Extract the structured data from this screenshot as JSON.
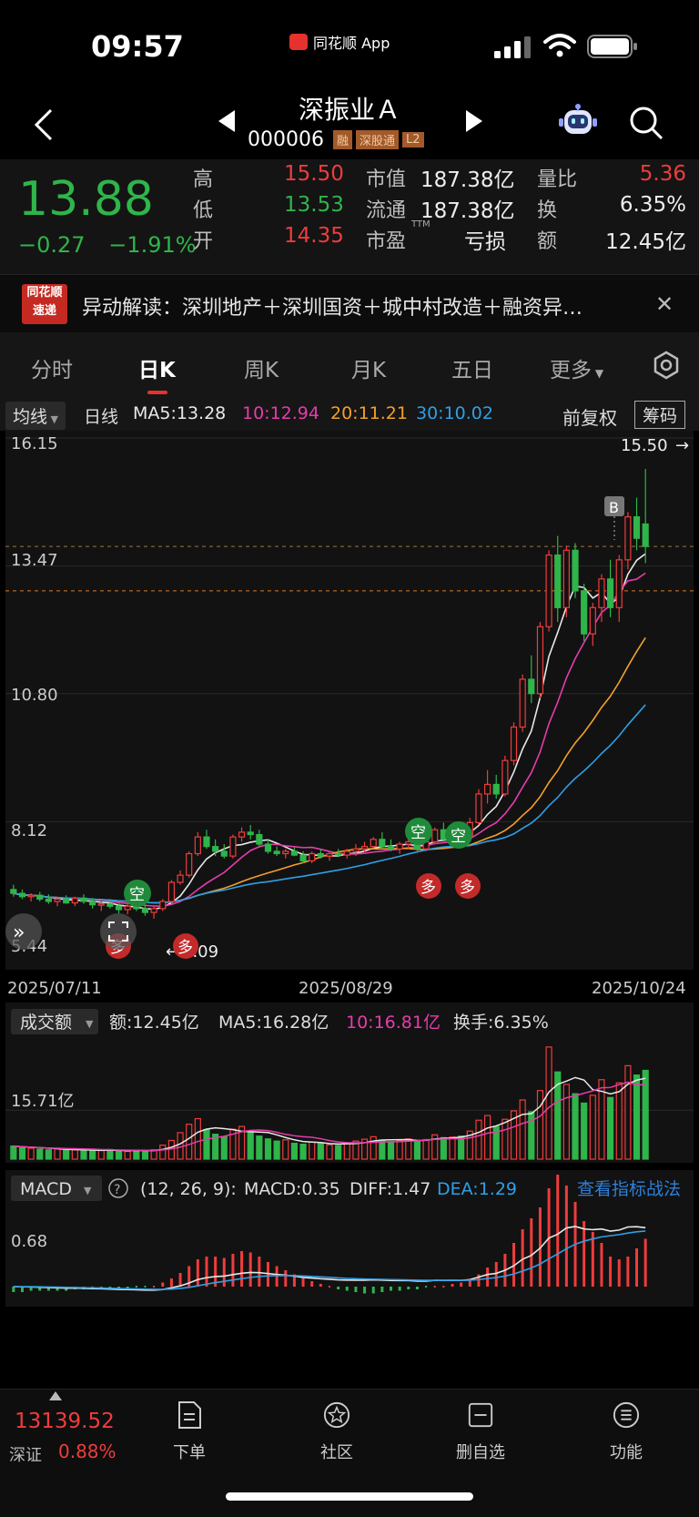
{
  "status_bar": {
    "time": "09:57",
    "app_label": "同花顺 App"
  },
  "nav": {
    "title": "深振业Ａ",
    "code": "000006",
    "tags": [
      "融",
      "深股通",
      "L2"
    ]
  },
  "quote": {
    "price": "13.88",
    "change": "−0.27",
    "change_pct": "−1.91%",
    "high_label": "高",
    "high": "15.50",
    "low_label": "低",
    "low": "13.53",
    "open_label": "开",
    "open": "14.35",
    "mktcap_label": "市值",
    "mktcap": "187.38亿",
    "float_label": "流通",
    "float": "187.38亿",
    "pe_label": "市盈",
    "pe_sup": "TTM",
    "pe": "亏损",
    "volratio_label": "量比",
    "volratio": "5.36",
    "turnover_label": "换",
    "turnover": "6.35%",
    "amount_label": "额",
    "amount": "12.45亿"
  },
  "news": {
    "logo_line1": "同花顺",
    "logo_line2": "速递",
    "text": "异动解读：深圳地产＋深圳国资＋城中村改造＋融资异…"
  },
  "tabs": [
    "分时",
    "日K",
    "周K",
    "月K",
    "五日",
    "更多"
  ],
  "active_tab": 1,
  "kline_header": {
    "indicator": "均线",
    "period": "日线",
    "ma5": "MA5:13.28",
    "ma10": "10:12.94",
    "ma20": "20:11.21",
    "ma30": "30:10.02",
    "adjust": "前复权",
    "chips": "筹码"
  },
  "colors": {
    "up": "#f03c3c",
    "down": "#2fb54a",
    "ma5": "#e8e8e8",
    "ma10": "#e63cac",
    "ma20": "#f2a02a",
    "ma30": "#2f9fe6",
    "dea": "#2f9fe6"
  },
  "chart": {
    "y_ticks": [
      "16.15",
      "13.47",
      "10.80",
      "8.12",
      "5.44"
    ],
    "max_label": "15.50",
    "min_label": "6.09",
    "dates": [
      "2025/07/11",
      "2025/08/29",
      "2025/10/24"
    ],
    "markers": {
      "buy": "B",
      "long": "多",
      "short": "空"
    }
  },
  "volume_header": {
    "indicator": "成交额",
    "amount": "额:12.45亿",
    "ma5": "MA5:16.28亿",
    "ma10": "10:16.81亿",
    "turnover": "换手:6.35%",
    "y_tick": "15.71亿"
  },
  "macd_header": {
    "indicator": "MACD",
    "params": "(12, 26, 9):",
    "macd": "MACD:0.35",
    "diff": "DIFF:1.47",
    "dea": "DEA:1.29",
    "link": "查看指标战法",
    "y_tick": "0.68"
  },
  "chart_data": {
    "type": "candlestick",
    "ohlc": [
      [
        6.7,
        6.8,
        6.55,
        6.62
      ],
      [
        6.62,
        6.7,
        6.5,
        6.55
      ],
      [
        6.55,
        6.62,
        6.45,
        6.58
      ],
      [
        6.58,
        6.65,
        6.45,
        6.5
      ],
      [
        6.5,
        6.6,
        6.4,
        6.45
      ],
      [
        6.45,
        6.55,
        6.35,
        6.5
      ],
      [
        6.5,
        6.58,
        6.4,
        6.42
      ],
      [
        6.42,
        6.55,
        6.35,
        6.52
      ],
      [
        6.52,
        6.6,
        6.4,
        6.45
      ],
      [
        6.45,
        6.52,
        6.3,
        6.38
      ],
      [
        6.38,
        6.45,
        6.25,
        6.4
      ],
      [
        6.4,
        6.5,
        6.3,
        6.35
      ],
      [
        6.35,
        6.42,
        6.2,
        6.28
      ],
      [
        6.28,
        6.4,
        6.18,
        6.35
      ],
      [
        6.35,
        6.42,
        6.25,
        6.3
      ],
      [
        6.3,
        6.38,
        6.15,
        6.22
      ],
      [
        6.22,
        6.35,
        6.09,
        6.3
      ],
      [
        6.3,
        6.5,
        6.25,
        6.45
      ],
      [
        6.45,
        6.9,
        6.4,
        6.85
      ],
      [
        6.85,
        7.1,
        6.8,
        7.0
      ],
      [
        7.0,
        7.5,
        6.95,
        7.45
      ],
      [
        7.45,
        7.9,
        7.4,
        7.8
      ],
      [
        7.8,
        7.95,
        7.55,
        7.6
      ],
      [
        7.6,
        7.75,
        7.4,
        7.5
      ],
      [
        7.5,
        7.65,
        7.35,
        7.4
      ],
      [
        7.4,
        7.85,
        7.35,
        7.8
      ],
      [
        7.8,
        8.0,
        7.7,
        7.9
      ],
      [
        7.9,
        8.05,
        7.75,
        7.85
      ],
      [
        7.85,
        7.95,
        7.6,
        7.65
      ],
      [
        7.65,
        7.75,
        7.45,
        7.5
      ],
      [
        7.5,
        7.6,
        7.4,
        7.45
      ],
      [
        7.45,
        7.55,
        7.35,
        7.5
      ],
      [
        7.5,
        7.58,
        7.4,
        7.42
      ],
      [
        7.42,
        7.5,
        7.25,
        7.3
      ],
      [
        7.3,
        7.5,
        7.25,
        7.45
      ],
      [
        7.45,
        7.55,
        7.35,
        7.4
      ],
      [
        7.4,
        7.5,
        7.3,
        7.45
      ],
      [
        7.45,
        7.55,
        7.38,
        7.42
      ],
      [
        7.42,
        7.55,
        7.35,
        7.5
      ],
      [
        7.5,
        7.65,
        7.4,
        7.55
      ],
      [
        7.55,
        7.7,
        7.48,
        7.6
      ],
      [
        7.6,
        7.8,
        7.55,
        7.75
      ],
      [
        7.75,
        7.9,
        7.55,
        7.6
      ],
      [
        7.6,
        7.75,
        7.5,
        7.55
      ],
      [
        7.55,
        7.7,
        7.45,
        7.65
      ],
      [
        7.65,
        7.8,
        7.55,
        7.7
      ],
      [
        7.7,
        7.85,
        7.5,
        7.55
      ],
      [
        7.55,
        7.75,
        7.5,
        7.7
      ],
      [
        7.7,
        8.0,
        7.65,
        7.95
      ],
      [
        7.95,
        8.1,
        7.7,
        7.75
      ],
      [
        7.75,
        7.9,
        7.65,
        7.85
      ],
      [
        7.85,
        8.0,
        7.7,
        7.8
      ],
      [
        7.8,
        8.2,
        7.75,
        8.1
      ],
      [
        8.1,
        8.8,
        8.05,
        8.7
      ],
      [
        8.7,
        9.2,
        8.5,
        8.9
      ],
      [
        8.9,
        9.1,
        8.6,
        8.7
      ],
      [
        8.7,
        9.5,
        8.65,
        9.4
      ],
      [
        9.4,
        10.2,
        9.3,
        10.1
      ],
      [
        10.1,
        11.2,
        10.0,
        11.1
      ],
      [
        11.1,
        11.6,
        10.6,
        10.8
      ],
      [
        10.8,
        12.3,
        10.7,
        12.2
      ],
      [
        12.2,
        13.8,
        12.1,
        13.7
      ],
      [
        13.7,
        14.1,
        12.3,
        12.6
      ],
      [
        12.6,
        13.9,
        12.4,
        13.8
      ],
      [
        13.8,
        13.95,
        12.8,
        12.95
      ],
      [
        12.95,
        13.1,
        11.9,
        12.05
      ],
      [
        12.05,
        12.7,
        11.8,
        12.6
      ],
      [
        12.6,
        13.3,
        12.3,
        13.2
      ],
      [
        13.2,
        13.6,
        12.4,
        12.6
      ],
      [
        12.6,
        13.7,
        12.3,
        13.6
      ],
      [
        13.6,
        14.6,
        13.4,
        14.5
      ],
      [
        14.5,
        14.9,
        13.8,
        14.05
      ],
      [
        14.35,
        15.5,
        13.53,
        13.88
      ]
    ],
    "volume_yi": [
      4.2,
      3.8,
      3.5,
      3.2,
      3.0,
      3.3,
      2.8,
      3.0,
      2.9,
      2.6,
      2.8,
      3.1,
      2.7,
      2.5,
      2.9,
      2.6,
      3.0,
      4.5,
      6.0,
      8.5,
      11.2,
      13.0,
      9.5,
      8.0,
      7.2,
      9.6,
      10.5,
      8.8,
      7.4,
      6.5,
      5.8,
      6.2,
      5.1,
      4.8,
      5.5,
      5.0,
      4.6,
      4.4,
      5.2,
      5.8,
      6.4,
      7.2,
      6.1,
      5.6,
      6.0,
      6.5,
      5.8,
      6.3,
      7.8,
      6.9,
      7.1,
      7.4,
      9.0,
      12.5,
      14.0,
      10.5,
      12.8,
      15.5,
      19.0,
      15.2,
      22.0,
      36.0,
      28.0,
      24.0,
      21.0,
      18.0,
      20.5,
      25.5,
      19.8,
      24.5,
      30.0,
      27.0,
      28.5
    ],
    "macd_hist": [
      -0.04,
      -0.04,
      -0.03,
      -0.03,
      -0.03,
      -0.03,
      -0.03,
      -0.02,
      -0.02,
      -0.02,
      -0.02,
      -0.02,
      -0.02,
      -0.02,
      -0.01,
      -0.01,
      0.01,
      0.03,
      0.06,
      0.1,
      0.15,
      0.2,
      0.22,
      0.22,
      0.21,
      0.24,
      0.26,
      0.25,
      0.22,
      0.18,
      0.15,
      0.12,
      0.09,
      0.06,
      0.04,
      0.02,
      0.0,
      -0.02,
      -0.03,
      -0.04,
      -0.05,
      -0.05,
      -0.04,
      -0.03,
      -0.03,
      -0.02,
      -0.02,
      -0.01,
      0.01,
      0.01,
      0.02,
      0.03,
      0.05,
      0.09,
      0.14,
      0.18,
      0.24,
      0.32,
      0.42,
      0.5,
      0.58,
      0.72,
      0.82,
      0.74,
      0.62,
      0.48,
      0.4,
      0.32,
      0.22,
      0.2,
      0.22,
      0.28,
      0.35
    ],
    "ylim": [
      5.44,
      16.15
    ]
  }
}
